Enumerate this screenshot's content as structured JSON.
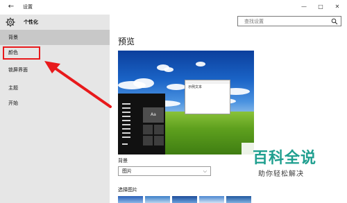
{
  "window": {
    "title": "设置",
    "back_glyph": "←",
    "minimize_glyph": "—",
    "restore_glyph": "□",
    "close_glyph": "✕"
  },
  "sidebar": {
    "home_label": "个性化",
    "items": [
      {
        "label": "背景",
        "selected": true
      },
      {
        "label": "颜色",
        "selected": false
      },
      {
        "label": "锁屏界面",
        "selected": false
      },
      {
        "label": "主题",
        "selected": false
      },
      {
        "label": "开始",
        "selected": false
      }
    ]
  },
  "search": {
    "placeholder": "查找设置"
  },
  "main": {
    "title": "预览",
    "preview": {
      "tile_label": "Aa",
      "sample_window_text": "示例文本"
    },
    "background_label": "背景",
    "background_value": "图片",
    "choose_picture_label": "选择图片"
  },
  "watermark": {
    "main": "百科全说",
    "sub": "助你轻松解决"
  },
  "colors": {
    "annotation_red": "#e8191b",
    "sidebar_bg": "#e6e6e6",
    "selected_bg": "#c8c8c8",
    "watermark_teal": "#1f9f8f"
  }
}
